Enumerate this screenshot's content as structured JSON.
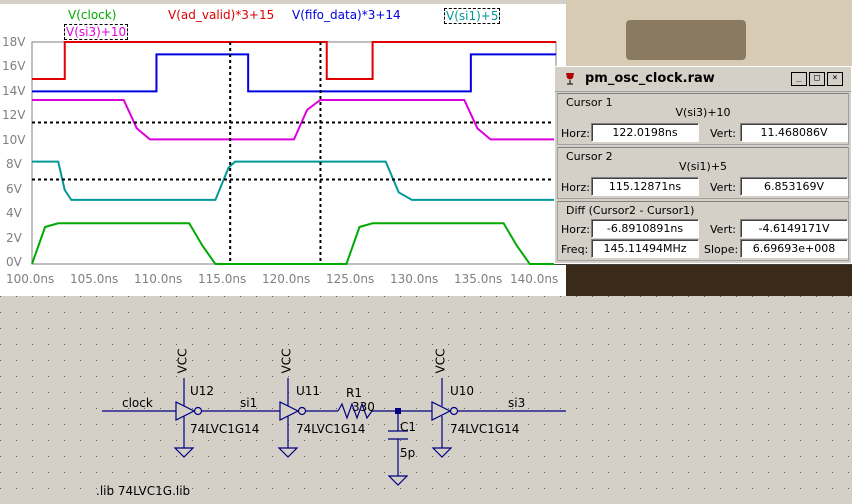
{
  "waveform": {
    "legend": [
      {
        "label": "V(clock)",
        "color": "#00aa00"
      },
      {
        "label": "V(ad_valid)*3+15",
        "color": "#e00000"
      },
      {
        "label": "V(fifo_data)*3+14",
        "color": "#0000e0"
      },
      {
        "label": "V(si1)+5",
        "color": "#009999"
      },
      {
        "label": "V(si3)+10",
        "color": "#dd00dd"
      }
    ],
    "y_ticks": [
      "18V",
      "16V",
      "14V",
      "12V",
      "10V",
      "8V",
      "6V",
      "4V",
      "2V",
      "0V"
    ],
    "x_ticks": [
      "100.0ns",
      "105.0ns",
      "110.0ns",
      "115.0ns",
      "120.0ns",
      "125.0ns",
      "130.0ns",
      "135.0ns",
      "140.0ns"
    ]
  },
  "chart_data": {
    "type": "line",
    "xlabel": "",
    "ylabel": "",
    "xlim": [
      100,
      140
    ],
    "ylim": [
      0,
      18
    ],
    "x_unit": "ns",
    "y_unit": "V",
    "series": [
      {
        "name": "V(clock)",
        "color": "#00aa00",
        "points": [
          [
            100,
            0
          ],
          [
            101,
            3
          ],
          [
            102,
            3.3
          ],
          [
            112,
            3.3
          ],
          [
            113,
            1.5
          ],
          [
            114,
            0
          ],
          [
            124,
            0
          ],
          [
            125,
            3
          ],
          [
            126,
            3.3
          ],
          [
            136,
            3.3
          ],
          [
            137,
            1.5
          ],
          [
            138,
            0
          ],
          [
            140,
            0
          ]
        ]
      },
      {
        "name": "V(ad_valid)*3+15",
        "color": "#e00000",
        "points": [
          [
            100,
            15
          ],
          [
            102.5,
            15
          ],
          [
            102.5,
            18
          ],
          [
            122.5,
            18
          ],
          [
            122.5,
            15
          ],
          [
            126,
            15
          ],
          [
            126,
            18
          ],
          [
            140,
            18
          ]
        ]
      },
      {
        "name": "V(fifo_data)*3+14",
        "color": "#0000e0",
        "points": [
          [
            100,
            14
          ],
          [
            109.5,
            14
          ],
          [
            109.5,
            17
          ],
          [
            116.5,
            17
          ],
          [
            116.5,
            14
          ],
          [
            133.5,
            14
          ],
          [
            133.5,
            17
          ],
          [
            140,
            17
          ]
        ]
      },
      {
        "name": "V(si1)+5",
        "color": "#009999",
        "points": [
          [
            100,
            8.3
          ],
          [
            102,
            8.3
          ],
          [
            102.5,
            6
          ],
          [
            103,
            5.2
          ],
          [
            114,
            5.2
          ],
          [
            115,
            7.8
          ],
          [
            115.5,
            8.3
          ],
          [
            127,
            8.3
          ],
          [
            128,
            5.8
          ],
          [
            129,
            5.2
          ],
          [
            140,
            5.2
          ]
        ]
      },
      {
        "name": "V(si3)+10",
        "color": "#dd00dd",
        "points": [
          [
            100,
            13.3
          ],
          [
            107,
            13.3
          ],
          [
            108,
            11
          ],
          [
            109,
            10.1
          ],
          [
            120,
            10.1
          ],
          [
            121,
            12.5
          ],
          [
            122,
            13.3
          ],
          [
            133,
            13.3
          ],
          [
            134,
            11
          ],
          [
            135,
            10.1
          ],
          [
            140,
            10.1
          ]
        ]
      }
    ],
    "cursors": [
      {
        "x": 115.12871,
        "y": 6.853169
      },
      {
        "x": 122.0198,
        "y": 11.468086
      }
    ]
  },
  "cursor_window": {
    "title": "pm_osc_clock.raw",
    "buttons": [
      "_",
      "□",
      "×"
    ],
    "cursor1": {
      "label": "Cursor 1",
      "expr": "V(si3)+10",
      "horz_label": "Horz:",
      "horz": "122.0198ns",
      "vert_label": "Vert:",
      "vert": "11.468086V"
    },
    "cursor2": {
      "label": "Cursor 2",
      "expr": "V(si1)+5",
      "horz_label": "Horz:",
      "horz": "115.12871ns",
      "vert_label": "Vert:",
      "vert": "6.853169V"
    },
    "diff": {
      "label": "Diff (Cursor2 - Cursor1)",
      "horz_label": "Horz:",
      "horz": "-6.8910891ns",
      "vert_label": "Vert:",
      "vert": "-4.6149171V",
      "freq_label": "Freq:",
      "freq": "145.11494MHz",
      "slope_label": "Slope:",
      "slope": "6.69693e+008"
    }
  },
  "schematic": {
    "net_clock": "clock",
    "net_si1": "si1",
    "net_si3": "si3",
    "u12": "U12",
    "u11": "U11",
    "u10": "U10",
    "part1": "74LVC1G14",
    "part2": "74LVC1G14",
    "part3": "74LVC1G14",
    "vcc1": "VCC",
    "vcc2": "VCC",
    "vcc3": "VCC",
    "r1": "R1",
    "r1_val": "330",
    "c1": "C1",
    "c1_val": "5p",
    "lib": ".lib 74LVC1G.lib"
  }
}
